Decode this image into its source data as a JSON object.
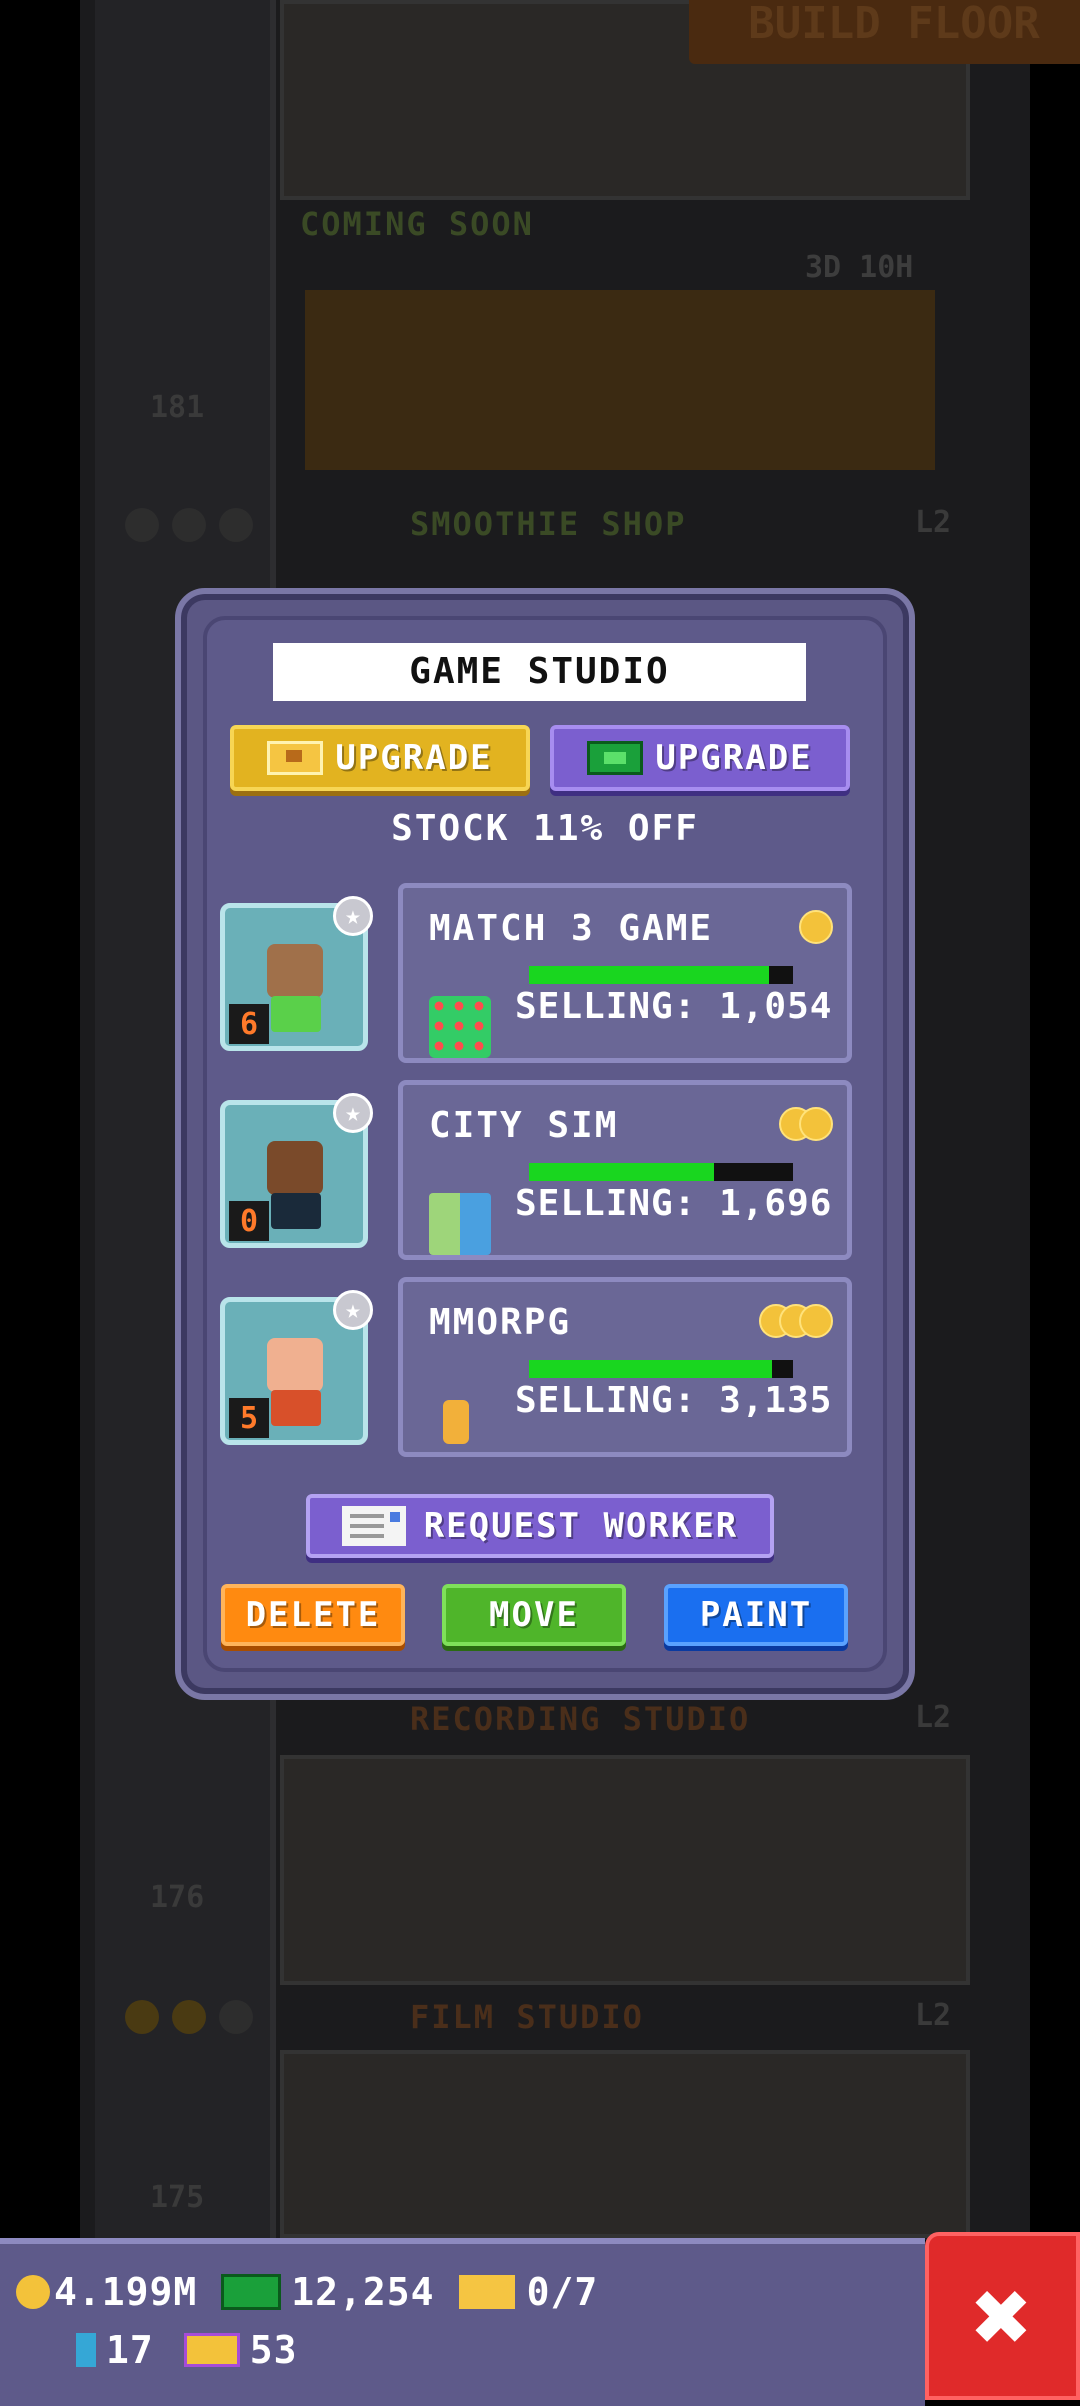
{
  "background": {
    "build_floor_label": "BUILD FLOOR",
    "coming_soon_label": "COMING SOON",
    "timer": "3D 10H",
    "floors": [
      {
        "number": "181",
        "name": "",
        "level": ""
      },
      {
        "number": "",
        "name": "SMOOTHIE SHOP",
        "level": "L2"
      },
      {
        "number": "",
        "name": "RECORDING STUDIO",
        "level": "L2"
      },
      {
        "number": "176",
        "name": "",
        "level": ""
      },
      {
        "number": "",
        "name": "FILM STUDIO",
        "level": "L2"
      },
      {
        "number": "175",
        "name": "",
        "level": ""
      }
    ]
  },
  "dialog": {
    "title": "GAME STUDIO",
    "upgrade_coins_label": "UPGRADE",
    "upgrade_bux_label": "UPGRADE",
    "stock_text": "STOCK 11% OFF",
    "workers": [
      {
        "level": "6",
        "skin": "#a0704a",
        "shirt": "#5ad04a"
      },
      {
        "level": "0",
        "skin": "#7a4a2a",
        "shirt": "#1a2a3a"
      },
      {
        "level": "5",
        "skin": "#f0b090",
        "shirt": "#d8502a"
      }
    ],
    "products": [
      {
        "name": "MATCH 3 GAME",
        "coins": 1,
        "progress": 0.91,
        "selling": "SELLING: 1,054",
        "icon": "gems-icon"
      },
      {
        "name": "CITY SIM",
        "coins": 2,
        "progress": 0.7,
        "selling": "SELLING: 1,696",
        "icon": "city-icon"
      },
      {
        "name": "MMORPG",
        "coins": 3,
        "progress": 0.92,
        "selling": "SELLING: 3,135",
        "icon": "warrior-icon"
      }
    ],
    "request_worker_label": "REQUEST WORKER",
    "delete_label": "DELETE",
    "move_label": "MOVE",
    "paint_label": "PAINT"
  },
  "hud": {
    "coins": "4.199M",
    "bux": "12,254",
    "tickets": "0/7",
    "bitizens": "17",
    "vip": "53"
  },
  "colors": {
    "dialog_bg": "#5e5a8a",
    "progress_fill": "#19d61f",
    "delete": "#ff8a10",
    "move": "#4fb52a",
    "paint": "#1a6ff0",
    "close": "#e02a2a"
  }
}
